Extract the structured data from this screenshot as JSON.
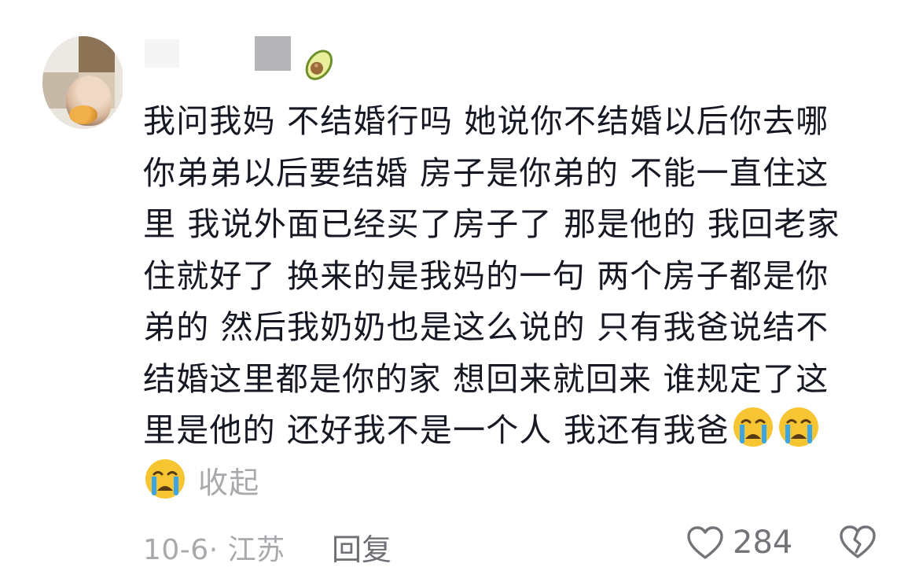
{
  "comment": {
    "lines": [
      "我问我妈 不结婚行吗 她说你不结婚以后你去哪",
      "你弟弟以后要结婚 房子是你弟的 不能一直住这",
      "里 我说外面已经买了房子了 那是他的 我回老家",
      "住就好了 换来的是我妈的一句 两个房子都是你",
      "弟的  然后我奶奶也是这么说的 只有我爸说结不",
      "结婚这里都是你的家 想回来就回来 谁规定了这",
      "里是他的 还好我不是一个人 我还有我爸"
    ],
    "collapse_label": "收起",
    "date_location": "10-6· 江苏",
    "reply_label": "回复",
    "like_count": "284"
  },
  "icons": {
    "avatar": "avatar",
    "name_badge": "avocado-icon",
    "emoji": "crying-face-emoji",
    "like": "heart-outline-icon",
    "dislike": "broken-heart-icon"
  },
  "colors": {
    "text": "#161823",
    "muted": "#a8a9ad",
    "reply": "#6f7076",
    "emoji_face": "#f7c531",
    "emoji_tears": "#3aa6e8"
  }
}
